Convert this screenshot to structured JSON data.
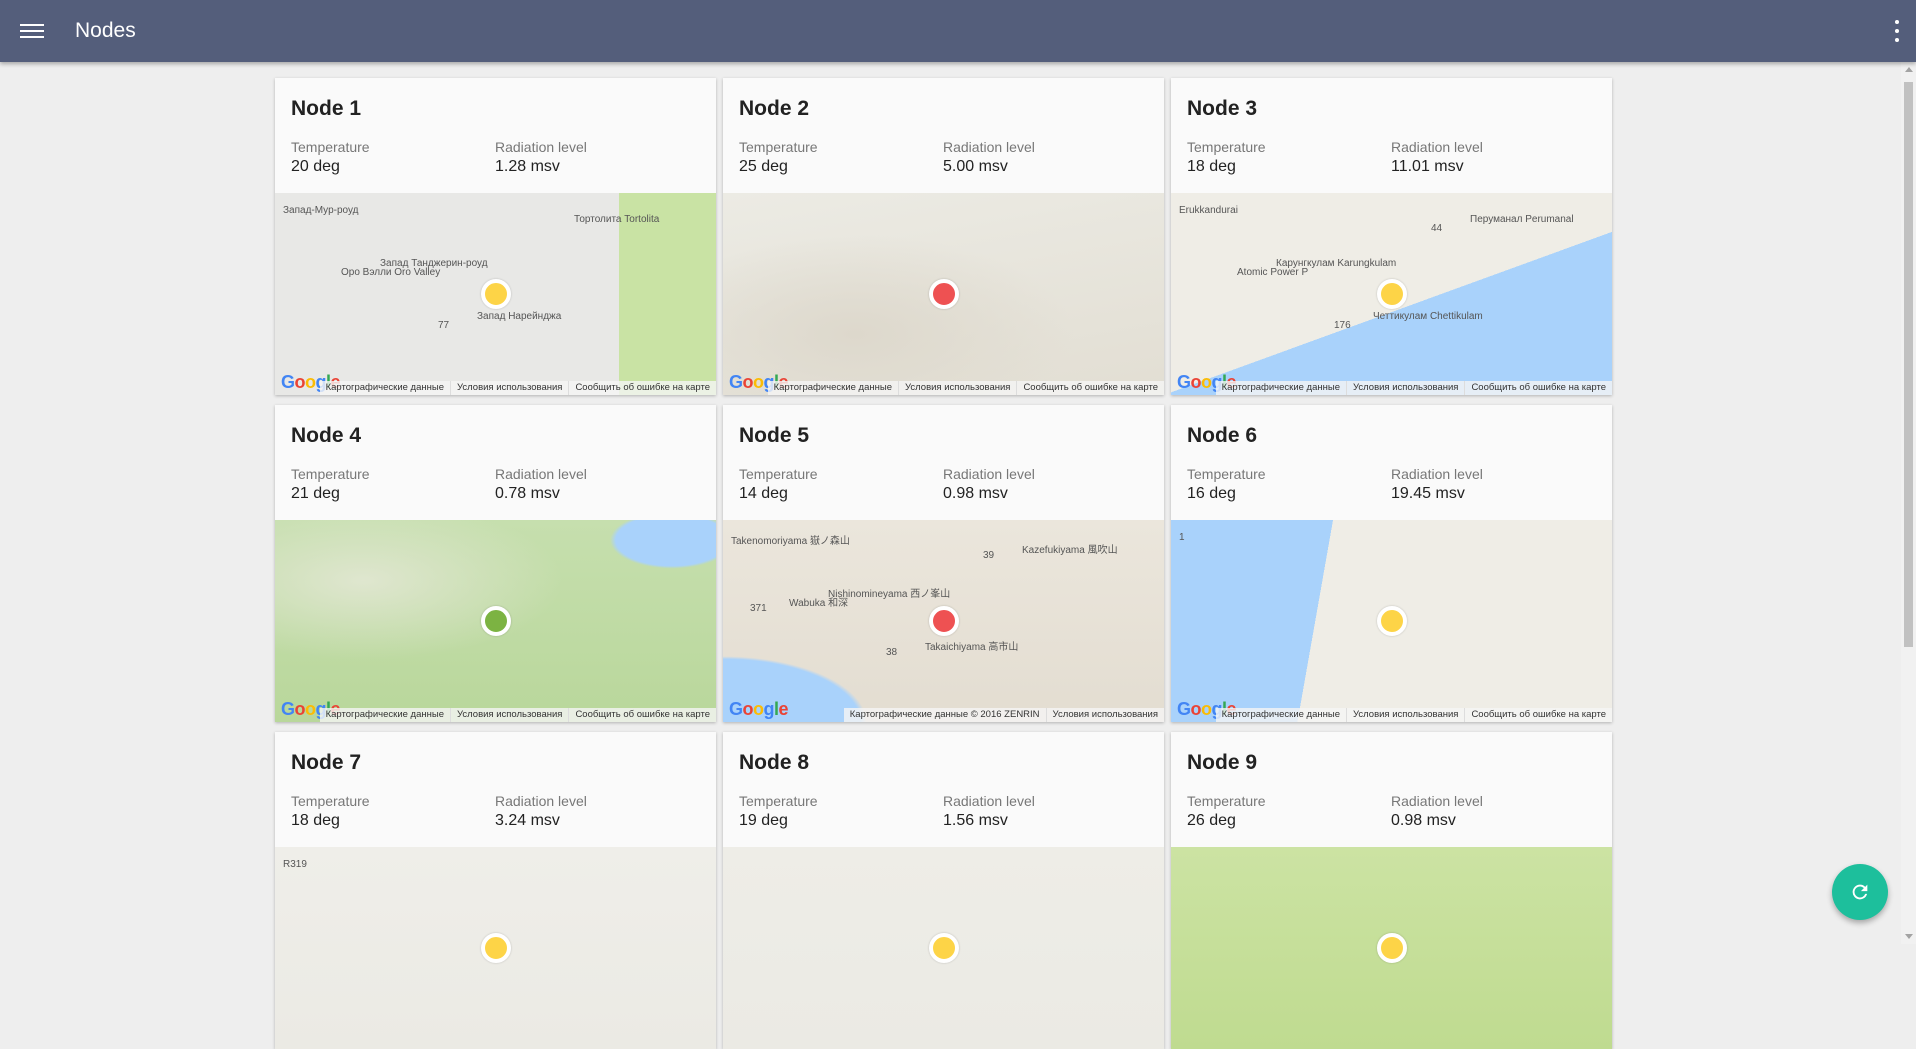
{
  "appbar": {
    "title": "Nodes",
    "menu_icon": "menu-icon",
    "more_icon": "more-vert-icon",
    "color": "#545e7b"
  },
  "labels": {
    "temperature": "Temperature",
    "radiation": "Radiation level"
  },
  "nodes": [
    {
      "name": "Node 1",
      "temperature": "20 deg",
      "radiation": "1.28 msv",
      "status_color": "#fdd447",
      "map_style": "roads-desert",
      "map_labels": [
        "Запад-Мур-роуд",
        "Запад Танджерин-роуд",
        "Запад Нарейнджа",
        "Тортолита Tortolita",
        "Оро Вэлли Oro Valley",
        "77"
      ],
      "attribution": [
        "Картографические данные",
        "Условия использования",
        "Сообщить об ошибке на карте"
      ]
    },
    {
      "name": "Node 2",
      "temperature": "25 deg",
      "radiation": "5.00 msv",
      "status_color": "#ee5152",
      "map_style": "terrain-river",
      "map_labels": [],
      "attribution": [
        "Картографические данные",
        "Условия использования",
        "Сообщить об ошибке на карте"
      ]
    },
    {
      "name": "Node 3",
      "temperature": "18 deg",
      "radiation": "11.01 msv",
      "status_color": "#fdd447",
      "map_style": "coast",
      "map_labels": [
        "Erukkandurai",
        "Карунгкулам Karungkulam",
        "Четтикулам Chettikulam",
        "Перуманал Perumanal",
        "Atomic Power P",
        "176",
        "44"
      ],
      "attribution": [
        "Картографические данные",
        "Условия использования",
        "Сообщить об ошибке на карте"
      ]
    },
    {
      "name": "Node 4",
      "temperature": "21 deg",
      "radiation": "0.78 msv",
      "status_color": "#7cb342",
      "map_style": "forest",
      "map_labels": [],
      "attribution": [
        "Картографические данные",
        "Условия использования",
        "Сообщить об ошибке на карте"
      ]
    },
    {
      "name": "Node 5",
      "temperature": "14 deg",
      "radiation": "0.98 msv",
      "status_color": "#ee5152",
      "map_style": "mountains",
      "map_labels": [
        "Takenomoriyama 嶽ノ森山",
        "Nishinomineyama 西ノ峯山",
        "Takaichiyama 高市山",
        "Kazefukiyama 風吹山",
        "Wabuka 和深",
        "38",
        "39",
        "371"
      ],
      "attribution": [
        "Картографические данные © 2016 ZENRIN",
        "Условия использования"
      ]
    },
    {
      "name": "Node 6",
      "temperature": "16 deg",
      "radiation": "19.45 msv",
      "status_color": "#fdd447",
      "map_style": "sea-left",
      "map_labels": [
        "1"
      ],
      "attribution": [
        "Картографические данные",
        "Условия использования",
        "Сообщить об ошибке на карте"
      ]
    },
    {
      "name": "Node 7",
      "temperature": "18 deg",
      "radiation": "3.24 msv",
      "status_color": "#fdd447",
      "map_style": "roads-light",
      "map_labels": [
        "R319"
      ],
      "attribution": []
    },
    {
      "name": "Node 8",
      "temperature": "19 deg",
      "radiation": "1.56 msv",
      "status_color": "#fdd447",
      "map_style": "plain",
      "map_labels": [],
      "attribution": []
    },
    {
      "name": "Node 9",
      "temperature": "26 deg",
      "radiation": "0.98 msv",
      "status_color": "#fdd447",
      "map_style": "green",
      "map_labels": [],
      "attribution": []
    }
  ],
  "map_logo": "Google",
  "fab": {
    "icon": "refresh-icon",
    "color": "#1dbf9c"
  }
}
